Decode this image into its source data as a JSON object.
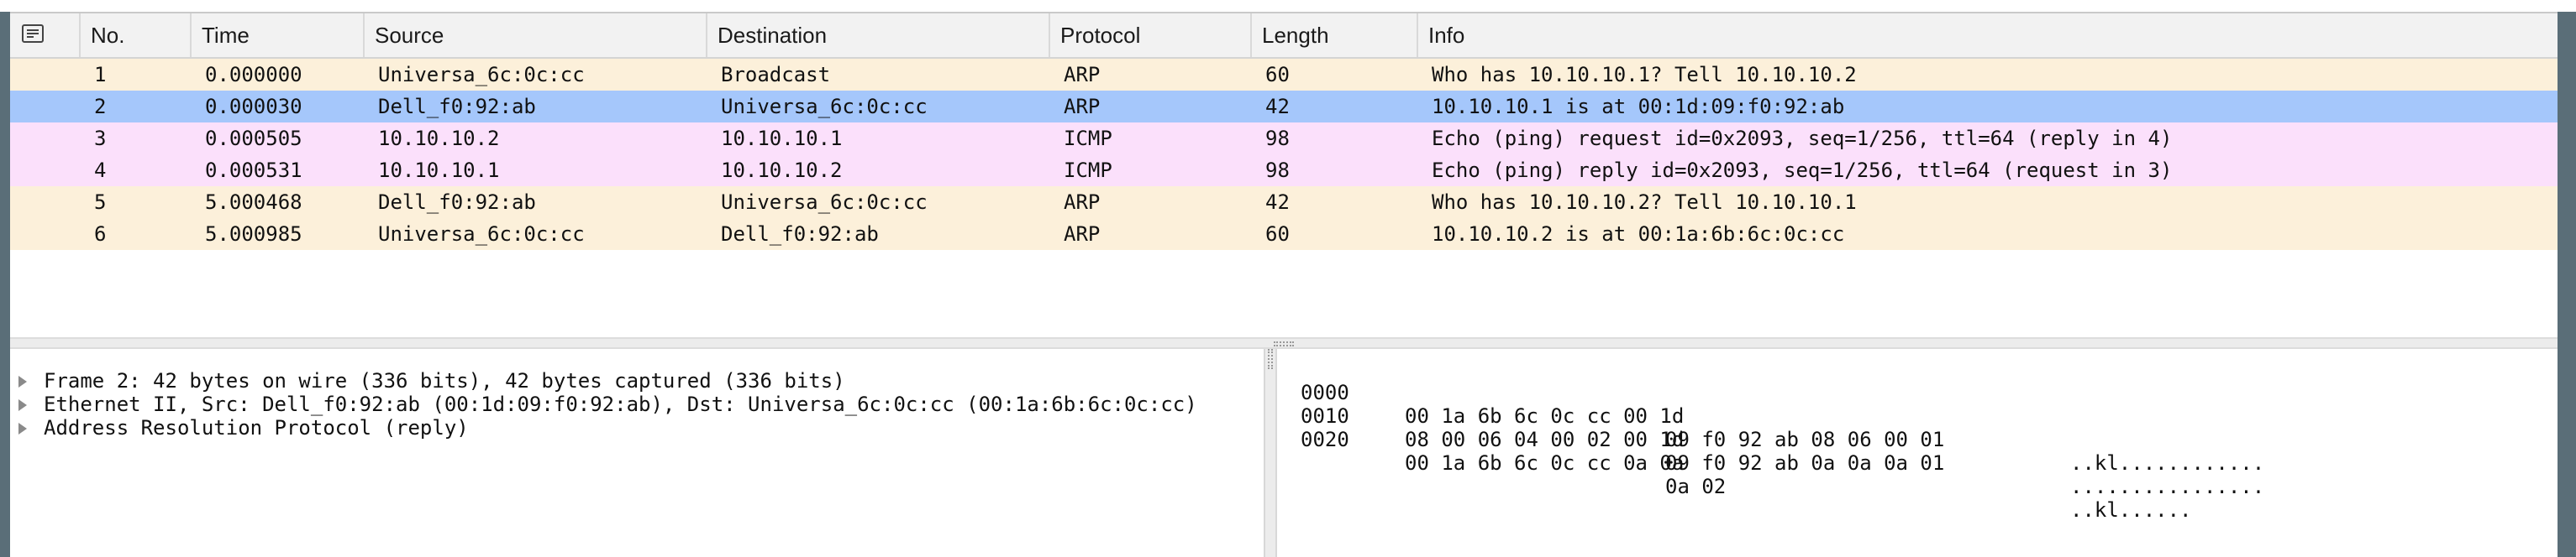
{
  "colors": {
    "arp_row": "#fcf0da",
    "selected_row": "#a5c7fb",
    "icmp_row": "#fbe0fb"
  },
  "column_headers": {
    "icon": "comment-icon",
    "no": "No.",
    "time": "Time",
    "source": "Source",
    "destination": "Destination",
    "protocol": "Protocol",
    "length": "Length",
    "info": "Info"
  },
  "packets": [
    {
      "no": "1",
      "time": "0.000000",
      "source": "Universa_6c:0c:cc",
      "destination": "Broadcast",
      "protocol": "ARP",
      "length": "60",
      "info": "Who has 10.10.10.1? Tell 10.10.10.2",
      "color": "#fcf0da"
    },
    {
      "no": "2",
      "time": "0.000030",
      "source": "Dell_f0:92:ab",
      "destination": "Universa_6c:0c:cc",
      "protocol": "ARP",
      "length": "42",
      "info": "10.10.10.1 is at 00:1d:09:f0:92:ab",
      "color": "#a5c7fb",
      "selected": true
    },
    {
      "no": "3",
      "time": "0.000505",
      "source": "10.10.10.2",
      "destination": "10.10.10.1",
      "protocol": "ICMP",
      "length": "98",
      "info": "Echo (ping) request  id=0x2093, seq=1/256, ttl=64 (reply in 4)",
      "color": "#fbe0fb"
    },
    {
      "no": "4",
      "time": "0.000531",
      "source": "10.10.10.1",
      "destination": "10.10.10.2",
      "protocol": "ICMP",
      "length": "98",
      "info": "Echo (ping) reply    id=0x2093, seq=1/256, ttl=64 (request in 3)",
      "color": "#fbe0fb"
    },
    {
      "no": "5",
      "time": "5.000468",
      "source": "Dell_f0:92:ab",
      "destination": "Universa_6c:0c:cc",
      "protocol": "ARP",
      "length": "42",
      "info": "Who has 10.10.10.2? Tell 10.10.10.1",
      "color": "#fcf0da"
    },
    {
      "no": "6",
      "time": "5.000985",
      "source": "Universa_6c:0c:cc",
      "destination": "Dell_f0:92:ab",
      "protocol": "ARP",
      "length": "60",
      "info": "10.10.10.2 is at 00:1a:6b:6c:0c:cc",
      "color": "#fcf0da"
    }
  ],
  "details": [
    {
      "label": "Frame 2: 42 bytes on wire (336 bits), 42 bytes captured (336 bits)",
      "icon": "expand-triangle-icon"
    },
    {
      "label": "Ethernet II, Src: Dell_f0:92:ab (00:1d:09:f0:92:ab), Dst: Universa_6c:0c:cc (00:1a:6b:6c:0c:cc)",
      "icon": "expand-triangle-icon"
    },
    {
      "label": "Address Resolution Protocol (reply)",
      "icon": "expand-triangle-icon"
    }
  ],
  "bytes": [
    {
      "offset": "0000",
      "hex1": "00 1a 6b 6c 0c cc 00 1d",
      "hex2": "09 f0 92 ab 08 06 00 01",
      "ascii": "..kl............"
    },
    {
      "offset": "0010",
      "hex1": "08 00 06 04 00 02 00 1d",
      "hex2": "09 f0 92 ab 0a 0a 0a 01",
      "ascii": "................"
    },
    {
      "offset": "0020",
      "hex1": "00 1a 6b 6c 0c cc 0a 0a",
      "hex2": "0a 02",
      "ascii": "..kl......"
    }
  ]
}
